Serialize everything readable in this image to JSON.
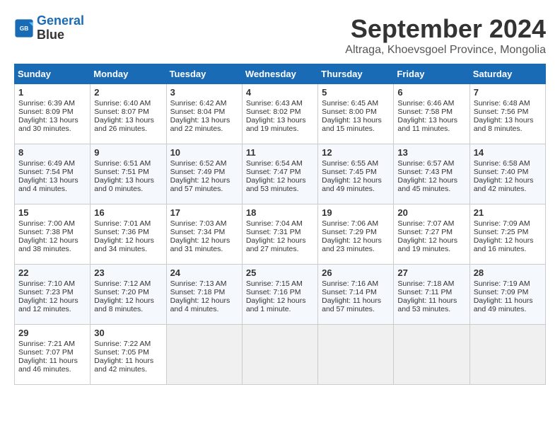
{
  "logo": {
    "line1": "General",
    "line2": "Blue"
  },
  "title": "September 2024",
  "subtitle": "Altraga, Khoevsgoel Province, Mongolia",
  "days_header": [
    "Sunday",
    "Monday",
    "Tuesday",
    "Wednesday",
    "Thursday",
    "Friday",
    "Saturday"
  ],
  "weeks": [
    [
      {
        "day": "1",
        "sunrise": "6:39 AM",
        "sunset": "8:09 PM",
        "daylight": "13 hours and 30 minutes."
      },
      {
        "day": "2",
        "sunrise": "6:40 AM",
        "sunset": "8:07 PM",
        "daylight": "13 hours and 26 minutes."
      },
      {
        "day": "3",
        "sunrise": "6:42 AM",
        "sunset": "8:04 PM",
        "daylight": "13 hours and 22 minutes."
      },
      {
        "day": "4",
        "sunrise": "6:43 AM",
        "sunset": "8:02 PM",
        "daylight": "13 hours and 19 minutes."
      },
      {
        "day": "5",
        "sunrise": "6:45 AM",
        "sunset": "8:00 PM",
        "daylight": "13 hours and 15 minutes."
      },
      {
        "day": "6",
        "sunrise": "6:46 AM",
        "sunset": "7:58 PM",
        "daylight": "13 hours and 11 minutes."
      },
      {
        "day": "7",
        "sunrise": "6:48 AM",
        "sunset": "7:56 PM",
        "daylight": "13 hours and 8 minutes."
      }
    ],
    [
      {
        "day": "8",
        "sunrise": "6:49 AM",
        "sunset": "7:54 PM",
        "daylight": "13 hours and 4 minutes."
      },
      {
        "day": "9",
        "sunrise": "6:51 AM",
        "sunset": "7:51 PM",
        "daylight": "13 hours and 0 minutes."
      },
      {
        "day": "10",
        "sunrise": "6:52 AM",
        "sunset": "7:49 PM",
        "daylight": "12 hours and 57 minutes."
      },
      {
        "day": "11",
        "sunrise": "6:54 AM",
        "sunset": "7:47 PM",
        "daylight": "12 hours and 53 minutes."
      },
      {
        "day": "12",
        "sunrise": "6:55 AM",
        "sunset": "7:45 PM",
        "daylight": "12 hours and 49 minutes."
      },
      {
        "day": "13",
        "sunrise": "6:57 AM",
        "sunset": "7:43 PM",
        "daylight": "12 hours and 45 minutes."
      },
      {
        "day": "14",
        "sunrise": "6:58 AM",
        "sunset": "7:40 PM",
        "daylight": "12 hours and 42 minutes."
      }
    ],
    [
      {
        "day": "15",
        "sunrise": "7:00 AM",
        "sunset": "7:38 PM",
        "daylight": "12 hours and 38 minutes."
      },
      {
        "day": "16",
        "sunrise": "7:01 AM",
        "sunset": "7:36 PM",
        "daylight": "12 hours and 34 minutes."
      },
      {
        "day": "17",
        "sunrise": "7:03 AM",
        "sunset": "7:34 PM",
        "daylight": "12 hours and 31 minutes."
      },
      {
        "day": "18",
        "sunrise": "7:04 AM",
        "sunset": "7:31 PM",
        "daylight": "12 hours and 27 minutes."
      },
      {
        "day": "19",
        "sunrise": "7:06 AM",
        "sunset": "7:29 PM",
        "daylight": "12 hours and 23 minutes."
      },
      {
        "day": "20",
        "sunrise": "7:07 AM",
        "sunset": "7:27 PM",
        "daylight": "12 hours and 19 minutes."
      },
      {
        "day": "21",
        "sunrise": "7:09 AM",
        "sunset": "7:25 PM",
        "daylight": "12 hours and 16 minutes."
      }
    ],
    [
      {
        "day": "22",
        "sunrise": "7:10 AM",
        "sunset": "7:23 PM",
        "daylight": "12 hours and 12 minutes."
      },
      {
        "day": "23",
        "sunrise": "7:12 AM",
        "sunset": "7:20 PM",
        "daylight": "12 hours and 8 minutes."
      },
      {
        "day": "24",
        "sunrise": "7:13 AM",
        "sunset": "7:18 PM",
        "daylight": "12 hours and 4 minutes."
      },
      {
        "day": "25",
        "sunrise": "7:15 AM",
        "sunset": "7:16 PM",
        "daylight": "12 hours and 1 minute."
      },
      {
        "day": "26",
        "sunrise": "7:16 AM",
        "sunset": "7:14 PM",
        "daylight": "11 hours and 57 minutes."
      },
      {
        "day": "27",
        "sunrise": "7:18 AM",
        "sunset": "7:11 PM",
        "daylight": "11 hours and 53 minutes."
      },
      {
        "day": "28",
        "sunrise": "7:19 AM",
        "sunset": "7:09 PM",
        "daylight": "11 hours and 49 minutes."
      }
    ],
    [
      {
        "day": "29",
        "sunrise": "7:21 AM",
        "sunset": "7:07 PM",
        "daylight": "11 hours and 46 minutes."
      },
      {
        "day": "30",
        "sunrise": "7:22 AM",
        "sunset": "7:05 PM",
        "daylight": "11 hours and 42 minutes."
      },
      null,
      null,
      null,
      null,
      null
    ]
  ]
}
